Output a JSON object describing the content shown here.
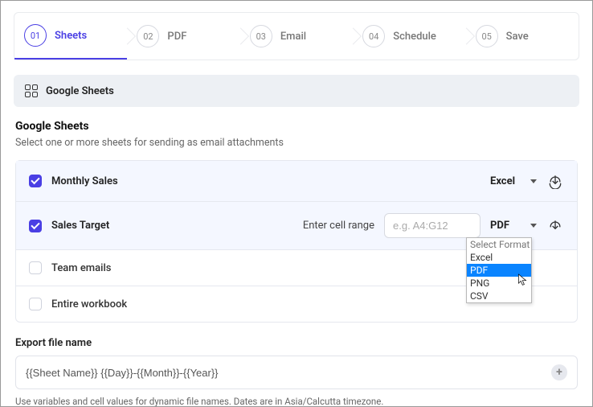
{
  "stepper": {
    "steps": [
      {
        "num": "01",
        "label": "Sheets",
        "active": true
      },
      {
        "num": "02",
        "label": "PDF",
        "active": false
      },
      {
        "num": "03",
        "label": "Email",
        "active": false
      },
      {
        "num": "04",
        "label": "Schedule",
        "active": false
      },
      {
        "num": "05",
        "label": "Save",
        "active": false
      }
    ]
  },
  "section": {
    "label": "Google Sheets"
  },
  "block": {
    "title": "Google Sheets",
    "subtitle": "Select one or more sheets for sending as email attachments"
  },
  "sheets": [
    {
      "name": "Monthly Sales",
      "checked": true,
      "format": "Excel",
      "show_range": false,
      "show_format": true
    },
    {
      "name": "Sales Target",
      "checked": true,
      "format": "PDF",
      "show_range": true,
      "range_label": "Enter cell range",
      "range_placeholder": "e.g. A4:G12",
      "show_format": true
    },
    {
      "name": "Team emails",
      "checked": false,
      "show_range": false,
      "show_format": false
    },
    {
      "name": "Entire workbook",
      "checked": false,
      "show_range": false,
      "show_format": false
    }
  ],
  "format_menu": {
    "placeholder": "Select Format",
    "options": [
      "Excel",
      "PDF",
      "PNG",
      "CSV"
    ],
    "highlighted": "PDF"
  },
  "export": {
    "label": "Export file name",
    "value": "{{Sheet Name}} {{Day}}-{{Month}}-{{Year}}",
    "helper": "Use variables and cell values for dynamic file names. Dates are in Asia/Calcutta timezone."
  }
}
